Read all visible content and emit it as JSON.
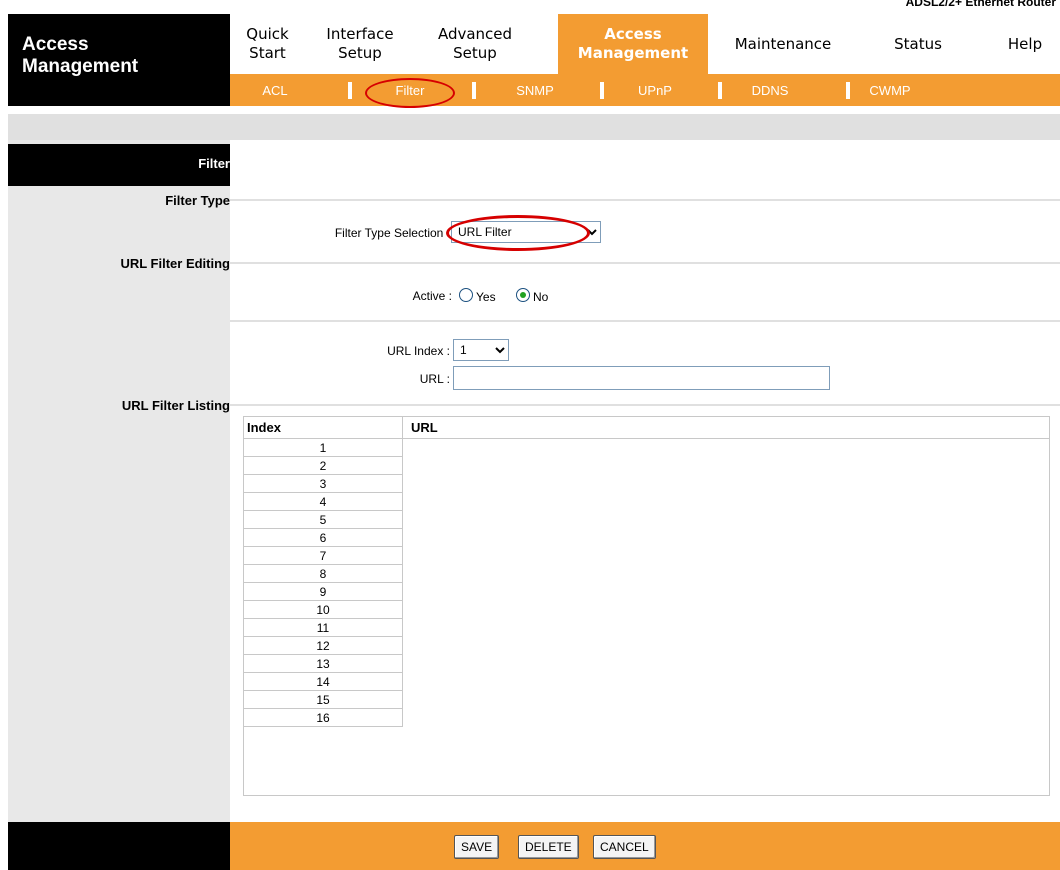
{
  "header": {
    "device_title": "ADSL2/2+ Ethernet Router",
    "section_title": "Access Management"
  },
  "nav": {
    "items": [
      {
        "label": "Quick Start"
      },
      {
        "label": "Interface Setup"
      },
      {
        "label": "Advanced Setup"
      },
      {
        "label": "Access Management"
      },
      {
        "label": "Maintenance"
      },
      {
        "label": "Status"
      },
      {
        "label": "Help"
      }
    ],
    "active": "Access Management"
  },
  "subnav": {
    "items": [
      {
        "label": "ACL"
      },
      {
        "label": "Filter"
      },
      {
        "label": "SNMP"
      },
      {
        "label": "UPnP"
      },
      {
        "label": "DDNS"
      },
      {
        "label": "CWMP"
      }
    ],
    "active": "Filter"
  },
  "sidebar": {
    "page_label": "Filter",
    "sections": {
      "filter_type": "Filter Type",
      "url_filter_editing": "URL Filter Editing",
      "url_filter_listing": "URL Filter Listing"
    }
  },
  "form": {
    "filter_type_label": "Filter Type Selection :",
    "filter_type_value": "URL Filter",
    "active_label": "Active :",
    "active_yes": "Yes",
    "active_no": "No",
    "active_selected": "No",
    "url_index_label": "URL Index :",
    "url_index_value": "1",
    "url_label": "URL :",
    "url_value": ""
  },
  "table": {
    "headers": {
      "index": "Index",
      "url": "URL"
    },
    "rows": [
      {
        "index": "1",
        "url": ""
      },
      {
        "index": "2",
        "url": ""
      },
      {
        "index": "3",
        "url": ""
      },
      {
        "index": "4",
        "url": ""
      },
      {
        "index": "5",
        "url": ""
      },
      {
        "index": "6",
        "url": ""
      },
      {
        "index": "7",
        "url": ""
      },
      {
        "index": "8",
        "url": ""
      },
      {
        "index": "9",
        "url": ""
      },
      {
        "index": "10",
        "url": ""
      },
      {
        "index": "11",
        "url": ""
      },
      {
        "index": "12",
        "url": ""
      },
      {
        "index": "13",
        "url": ""
      },
      {
        "index": "14",
        "url": ""
      },
      {
        "index": "15",
        "url": ""
      },
      {
        "index": "16",
        "url": ""
      }
    ]
  },
  "footer": {
    "save_label": "SAVE",
    "delete_label": "DELETE",
    "cancel_label": "CANCEL"
  },
  "colors": {
    "accent": "#f39c32",
    "highlight": "#d60000"
  }
}
